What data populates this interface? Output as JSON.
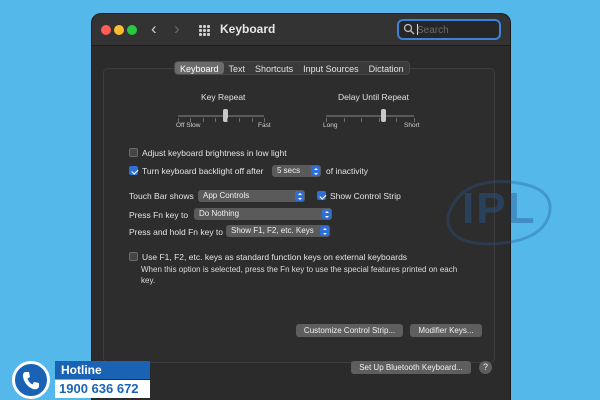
{
  "window": {
    "title": "Keyboard",
    "search_placeholder": "Search"
  },
  "tabs": [
    {
      "label": "Keyboard",
      "active": true
    },
    {
      "label": "Text",
      "active": false
    },
    {
      "label": "Shortcuts",
      "active": false
    },
    {
      "label": "Input Sources",
      "active": false
    },
    {
      "label": "Dictation",
      "active": false
    }
  ],
  "key_repeat": {
    "label": "Key Repeat",
    "left_labels": "Off  Slow",
    "right_label": "Fast",
    "level": 0.55
  },
  "delay_until_repeat": {
    "label": "Delay Until Repeat",
    "left_label": "Long",
    "right_label": "Short",
    "level": 0.65
  },
  "options": {
    "brightness_low_light": {
      "label": "Adjust keyboard brightness in low light",
      "checked": false
    },
    "backlight_off": {
      "label": "Turn keyboard backlight off after",
      "checked": true,
      "value": "5 secs",
      "suffix": "of inactivity"
    },
    "touch_bar": {
      "label": "Touch Bar shows",
      "value": "App Controls"
    },
    "control_strip": {
      "label": "Show Control Strip",
      "checked": true
    },
    "fn_key": {
      "label": "Press Fn key to",
      "value": "Do Nothing"
    },
    "hold_fn_key": {
      "label": "Press and hold Fn key to",
      "value": "Show F1, F2, etc. Keys"
    },
    "standard_fn_keys": {
      "label": "Use F1, F2, etc. keys as standard function keys on external keyboards",
      "description": "When this option is selected, press the Fn key to use the special features printed on each key.",
      "checked": false
    }
  },
  "buttons": {
    "customize_control_strip": "Customize Control Strip...",
    "modifier_keys": "Modifier Keys...",
    "bluetooth_keyboard": "Set Up Bluetooth Keyboard...",
    "help": "?"
  },
  "banner": {
    "hotline_label": "Hotline",
    "hotline_number": "1900 636 672",
    "watermark_brand": "IPL"
  },
  "colors": {
    "accent": "#2f6fd6",
    "background": "#54b9ea",
    "brand": "#1a63b4"
  },
  "icons": {
    "back": "chevron-left-icon",
    "forward": "chevron-right-icon",
    "grid": "grid-icon",
    "search": "search-icon",
    "phone": "phone-icon"
  }
}
